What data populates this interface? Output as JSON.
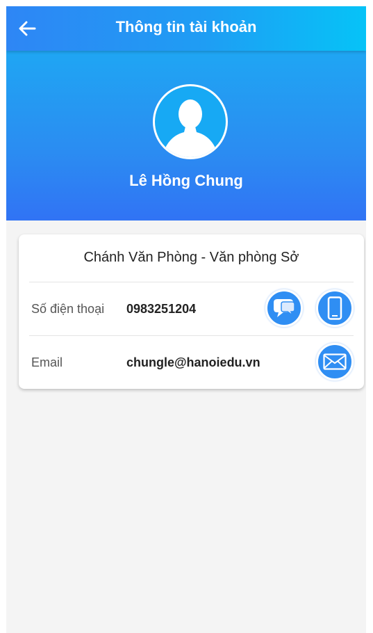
{
  "header": {
    "title": "Thông tin tài khoản",
    "back_icon": "arrow-left-icon"
  },
  "profile": {
    "name": "Lê Hồng Chung",
    "avatar_icon": "user-silhouette-icon"
  },
  "card": {
    "title": "Chánh Văn Phòng - Văn phòng Sở",
    "phone": {
      "label": "Số điện thoại",
      "value": "0983251204",
      "actions": [
        "chat-bubble-icon",
        "mobile-phone-icon"
      ]
    },
    "email": {
      "label": "Email",
      "value": "chungle@hanoiedu.vn",
      "actions": [
        "envelope-icon"
      ]
    }
  },
  "colors": {
    "header_start": "#2e86f5",
    "header_end": "#06c3f7",
    "profile_bg": "#2b8cf2",
    "action_button": "#2f8ef3",
    "page_bg": "#f4f4f4"
  }
}
